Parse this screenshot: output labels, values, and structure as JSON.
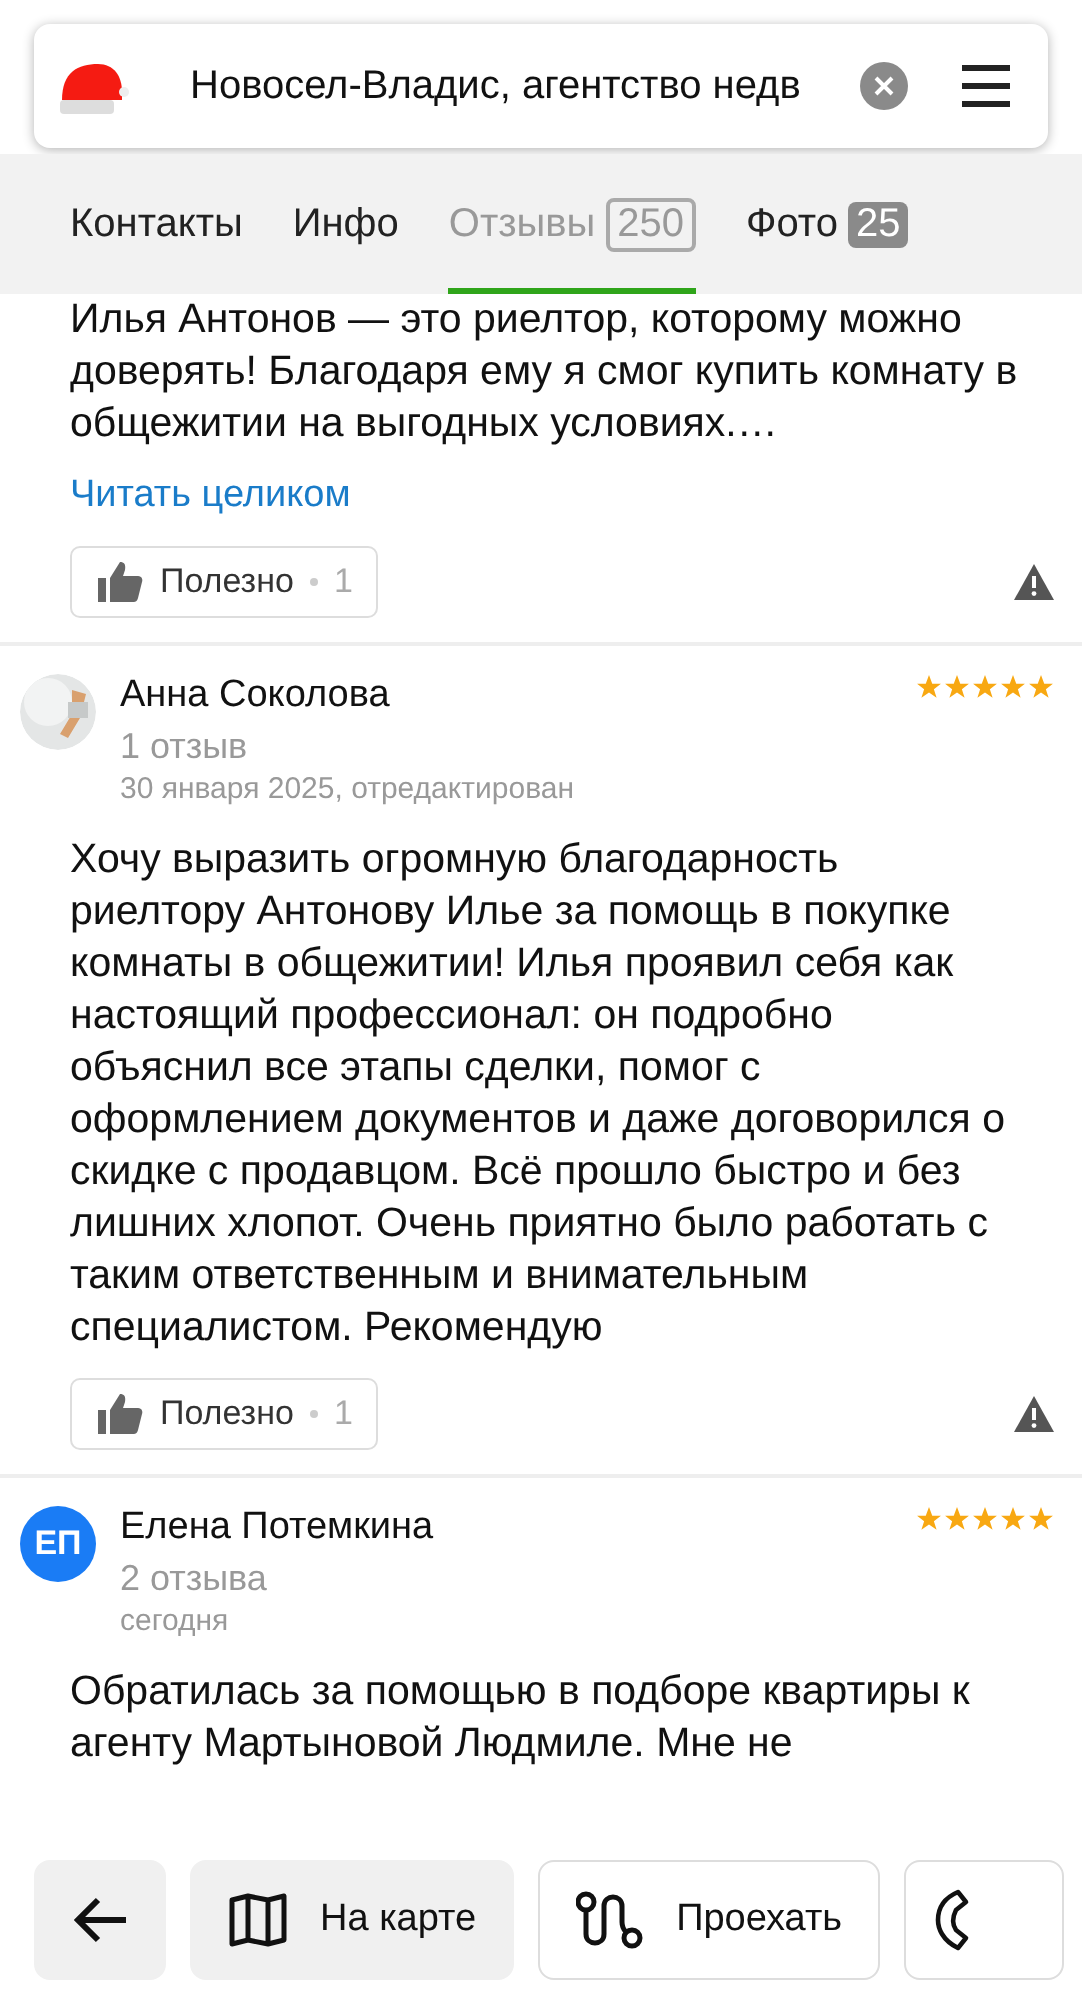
{
  "search": {
    "value": "Новосел-Владис, агентство недв"
  },
  "tabs": [
    {
      "label": "Контакты",
      "selected": false
    },
    {
      "label": "Инфо",
      "selected": false
    },
    {
      "label": "Отзывы",
      "count": "250",
      "selected": true
    },
    {
      "label": "Фото",
      "count": "25",
      "selected": false
    }
  ],
  "reviews": [
    {
      "text": "Илья Антонов — это риелтор, которому можно доверять! Благодаря ему я смог купить комнату в общежитии на выгодных условиях.…",
      "read_more": "Читать целиком",
      "useful": {
        "label": "Полезно",
        "count": "1"
      }
    },
    {
      "author": "Анна Соколова",
      "reviews_count": "1 отзыв",
      "date": "30 января 2025, отредактирован",
      "stars": 5,
      "text": "Хочу выразить огромную благодарность риелтору Антонову Илье за помощь в покупке комнаты в общежитии! Илья проявил себя как настоящий профессионал: он подробно объяснил все этапы сделки, помог с оформлением документов и даже договорился о скидке с продавцом. Всё прошло быстро и без лишних хлопот. Очень приятно было работать с таким ответственным и внимательным специалистом. Рекомендую",
      "useful": {
        "label": "Полезно",
        "count": "1"
      }
    },
    {
      "author": "Елена Потемкина",
      "avatar": {
        "kind": "initials",
        "initials": "ЕП",
        "color": "#1a7cf5"
      },
      "reviews_count": "2 отзыва",
      "date": "сегодня",
      "stars": 5,
      "text": "Обратилась за помощью в подборе квартиры к агенту Мартыновой Людмиле. Мне не"
    }
  ],
  "bottom_bar": [
    {
      "kind": "back"
    },
    {
      "kind": "map",
      "label": "На карте"
    },
    {
      "kind": "route",
      "label": "Проехать"
    },
    {
      "kind": "call"
    }
  ]
}
